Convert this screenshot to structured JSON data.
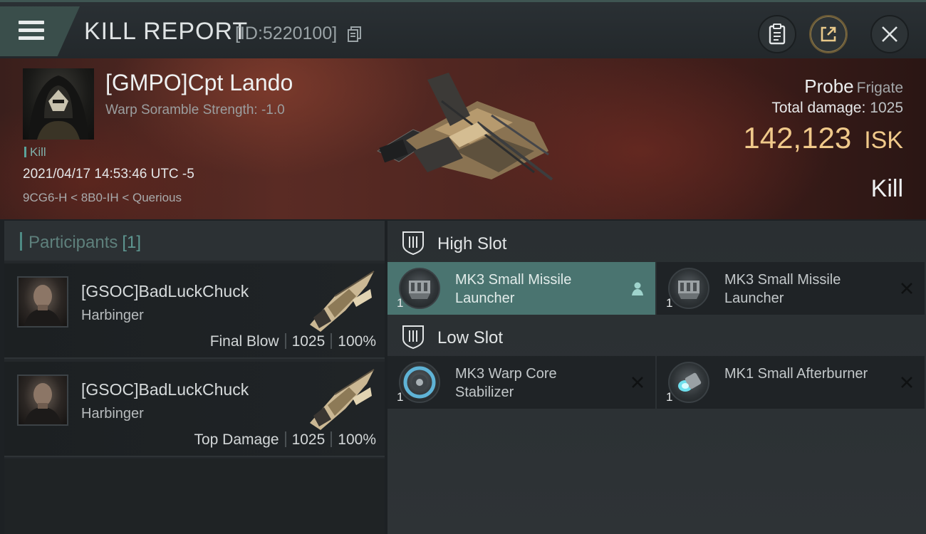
{
  "header": {
    "title": "KILL REPORT",
    "report_id": "[ID:5220100]"
  },
  "victim": {
    "name": "[GMPO]Cpt Lando",
    "scramble": "Warp Soramble Strength: -1.0",
    "tag": "Kill",
    "datetime": "2021/04/17 14:53:46 UTC -5",
    "location": "9CG6-H < 8B0-IH < Querious",
    "ship_name": "Probe",
    "ship_class": "Frigate",
    "damage_label": "Total damage:",
    "damage_value": "1025",
    "isk_value": "142,123",
    "isk_unit": "ISK",
    "result": "Kill"
  },
  "participants": {
    "title": "Participants",
    "count": "[1]",
    "items": [
      {
        "name": "[GSOC]BadLuckChuck",
        "ship": "Harbinger",
        "role": "Final Blow",
        "damage": "1025",
        "percent": "100%"
      },
      {
        "name": "[GSOC]BadLuckChuck",
        "ship": "Harbinger",
        "role": "Top Damage",
        "damage": "1025",
        "percent": "100%"
      }
    ]
  },
  "fitting": {
    "high_slot": {
      "title": "High Slot",
      "modules": [
        {
          "name": "MK3 Small Missile Launcher",
          "qty": "1",
          "status": "pilot-icon"
        },
        {
          "name": "MK3 Small Missile Launcher",
          "qty": "1",
          "status": "destroyed-icon"
        }
      ]
    },
    "low_slot": {
      "title": "Low Slot",
      "modules": [
        {
          "name": "MK3 Warp Core Stabilizer",
          "qty": "1",
          "status": "destroyed-icon"
        },
        {
          "name": "MK1 Small Afterburner",
          "qty": "1",
          "status": "destroyed-icon"
        }
      ]
    }
  },
  "colors": {
    "accent_teal": "#4a7470",
    "isk_gold": "#f0c98a"
  }
}
